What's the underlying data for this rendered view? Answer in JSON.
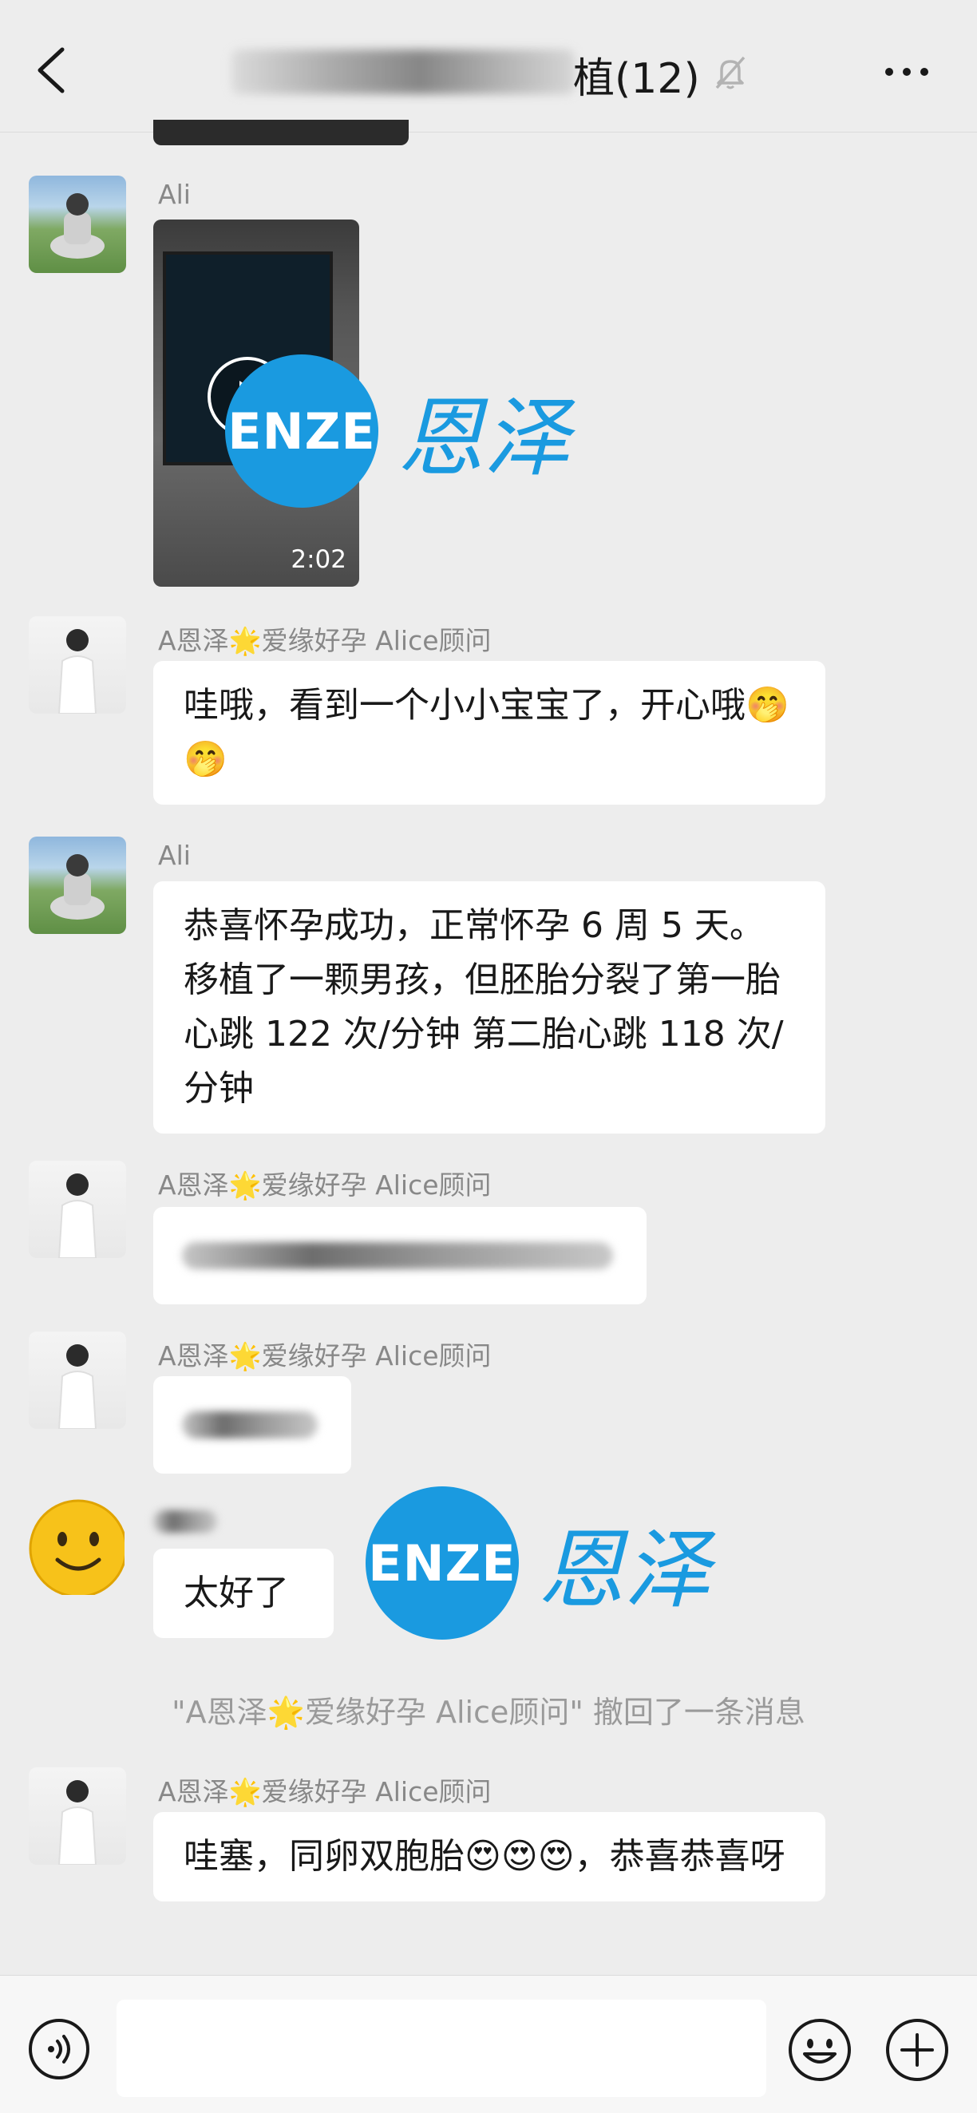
{
  "header": {
    "title_suffix": "植(12)",
    "icons": {
      "back": "chevron-left-icon",
      "mute": "bell-off-icon",
      "more": "more-dots-icon"
    }
  },
  "messages": [
    {
      "type": "video",
      "sender": "Ali",
      "duration": "2:02"
    },
    {
      "type": "text",
      "sender": "A恩泽🌟爱缘好孕 Alice顾问",
      "text": "哇哦，看到一个小小宝宝了，开心哦🤭🤭"
    },
    {
      "type": "text",
      "sender": "Ali",
      "text": "恭喜怀孕成功，正常怀孕 6 周 5 天。移植了一颗男孩，但胚胎分裂了第一胎心跳 122 次/分钟 第二胎心跳 118 次/分钟"
    },
    {
      "type": "text-blurred",
      "sender": "A恩泽🌟爱缘好孕 Alice顾问"
    },
    {
      "type": "text-blurred",
      "sender": "A恩泽🌟爱缘好孕 Alice顾问"
    },
    {
      "type": "text",
      "sender": "",
      "text": "太好了"
    },
    {
      "type": "text",
      "sender": "A恩泽🌟爱缘好孕 Alice顾问",
      "text": "哇塞，同卵双胞胎😍😍😍，恭喜恭喜呀"
    }
  ],
  "system_notice": "\"A恩泽🌟爱缘好孕 Alice顾问\" 撤回了一条消息",
  "watermark": {
    "logo_text": "ENZE",
    "cn_text": "恩泽"
  },
  "bottom_bar": {
    "input_value": "",
    "icons": {
      "voice": "voice-icon",
      "emoji": "emoji-icon",
      "plus": "plus-icon"
    }
  },
  "colors": {
    "brand_blue": "#1a9ae0",
    "bg": "#ededed",
    "bubble": "#ffffff"
  }
}
